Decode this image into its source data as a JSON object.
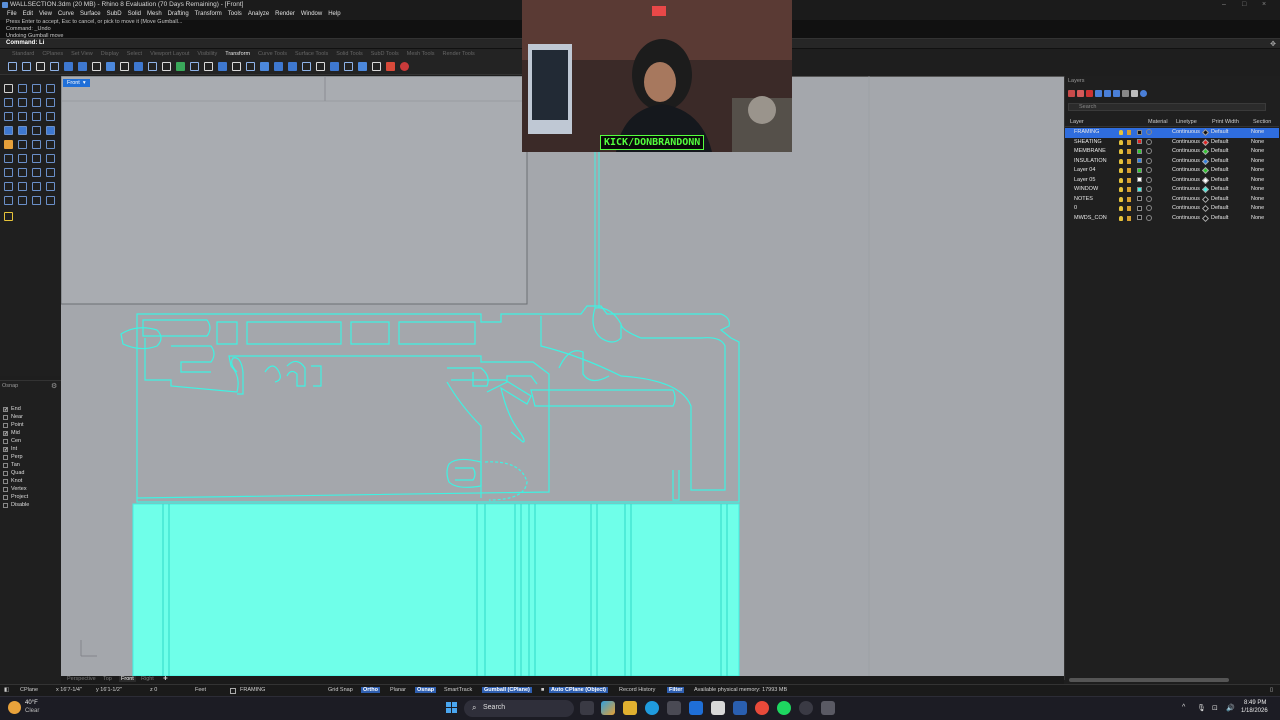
{
  "window": {
    "title": "WALLSECTION.3dm (20 MB) - Rhino 8 Evaluation (70 Days Remaining) - [Front]"
  },
  "menu": [
    "File",
    "Edit",
    "View",
    "Curve",
    "Surface",
    "SubD",
    "Solid",
    "Mesh",
    "Drafting",
    "Transform",
    "Tools",
    "Analyze",
    "Render",
    "Window",
    "Help"
  ],
  "command": {
    "history": [
      "Press Enter to accept, Esc to cancel, or pick to move it (Move Gumball...",
      "Command: _Undo",
      "Undoing Gumball move"
    ],
    "prompt": "Command: Li"
  },
  "toolbar_tabs": [
    "Standard",
    "CPlanes",
    "Set View",
    "Display",
    "Select",
    "Viewport Layout",
    "Visibility",
    "Transform",
    "Curve Tools",
    "Surface Tools",
    "Solid Tools",
    "SubD Tools",
    "Mesh Tools",
    "Render Tools"
  ],
  "active_toolbar_tab": "Transform",
  "viewport": {
    "name": "Front",
    "tabs": [
      "Perspective",
      "Top",
      "Front",
      "Right"
    ],
    "active_tab": "Front"
  },
  "osnap": {
    "title": "Osnap",
    "items": [
      {
        "label": "End",
        "checked": true
      },
      {
        "label": "Near",
        "checked": false
      },
      {
        "label": "Point",
        "checked": false
      },
      {
        "label": "Mid",
        "checked": true
      },
      {
        "label": "Cen",
        "checked": false
      },
      {
        "label": "Int",
        "checked": true
      },
      {
        "label": "Perp",
        "checked": false
      },
      {
        "label": "Tan",
        "checked": false
      },
      {
        "label": "Quad",
        "checked": false
      },
      {
        "label": "Knot",
        "checked": false
      },
      {
        "label": "Vertex",
        "checked": false
      },
      {
        "label": "Project",
        "checked": false
      },
      {
        "label": "Disable",
        "checked": false
      }
    ]
  },
  "layers": {
    "title": "Layers",
    "search_placeholder": "Search",
    "columns": [
      "Layer",
      "Material",
      "Linetype",
      "Print Width",
      "Section"
    ],
    "rows": [
      {
        "name": "FRAMING",
        "color": "#111111",
        "linetype": "Continuous",
        "print_color": "#111111",
        "width": "Default",
        "section": "None",
        "current": true
      },
      {
        "name": "SHEATING",
        "color": "#e02020",
        "linetype": "Continuous",
        "print_color": "#e02020",
        "width": "Default",
        "section": "None",
        "current": false
      },
      {
        "name": "MEMBRANE",
        "color": "#2fc72f",
        "linetype": "Continuous",
        "print_color": "#2fc72f",
        "width": "Default",
        "section": "None",
        "current": false
      },
      {
        "name": "INSULATION",
        "color": "#2f7fe0",
        "linetype": "Continuous",
        "print_color": "#2f7fe0",
        "width": "Default",
        "section": "None",
        "current": false
      },
      {
        "name": "Layer 04",
        "color": "#2fc72f",
        "linetype": "Continuous",
        "print_color": "#2fc72f",
        "width": "Default",
        "section": "None",
        "current": false
      },
      {
        "name": "Layer 05",
        "color": "#ffffff",
        "linetype": "Continuous",
        "print_color": "#ffffff",
        "width": "Default",
        "section": "None",
        "current": false
      },
      {
        "name": "WINDOW",
        "color": "#3ff2e2",
        "linetype": "Continuous",
        "print_color": "#3ff2e2",
        "width": "Default",
        "section": "None",
        "current": false
      },
      {
        "name": "NOTES",
        "color": "#111111",
        "linetype": "Continuous",
        "print_color": "#111111",
        "width": "Default",
        "section": "None",
        "current": false
      },
      {
        "name": "0",
        "color": "#111111",
        "linetype": "Continuous",
        "print_color": "#111111",
        "width": "Default",
        "section": "None",
        "current": false
      },
      {
        "name": "MWDS_CON",
        "color": "#111111",
        "linetype": "Continuous",
        "print_color": "#111111",
        "width": "Default",
        "section": "None",
        "current": false
      }
    ]
  },
  "status": {
    "cplane": "CPlane",
    "x": "x 16'7-1/4\"",
    "y": "y 16'1-1/2\"",
    "z": "z 0",
    "units": "Feet",
    "layer": "FRAMING",
    "grid_snap": "Grid Snap",
    "ortho": "Ortho",
    "planar": "Planar",
    "osnap": "Osnap",
    "smarttrack": "SmartTrack",
    "gumball": "Gumball (CPlane)",
    "auto_cplane": "Auto CPlane (Object)",
    "record_history": "Record History",
    "filter": "Filter",
    "memory": "Available physical memory: 17993 MB"
  },
  "webcam": {
    "overlay_text": "KICK/DONBRANDONN"
  },
  "taskbar": {
    "weather_temp": "40°F",
    "weather_desc": "Clear",
    "search_label": "Search",
    "time": "8:49 PM",
    "date": "1/18/2026"
  },
  "colors": {
    "viewport_bg": "#a4a7ac",
    "window_curve": "#3ff2e2",
    "window_fill": "#6fffe9",
    "accent": "#2f6dde"
  }
}
